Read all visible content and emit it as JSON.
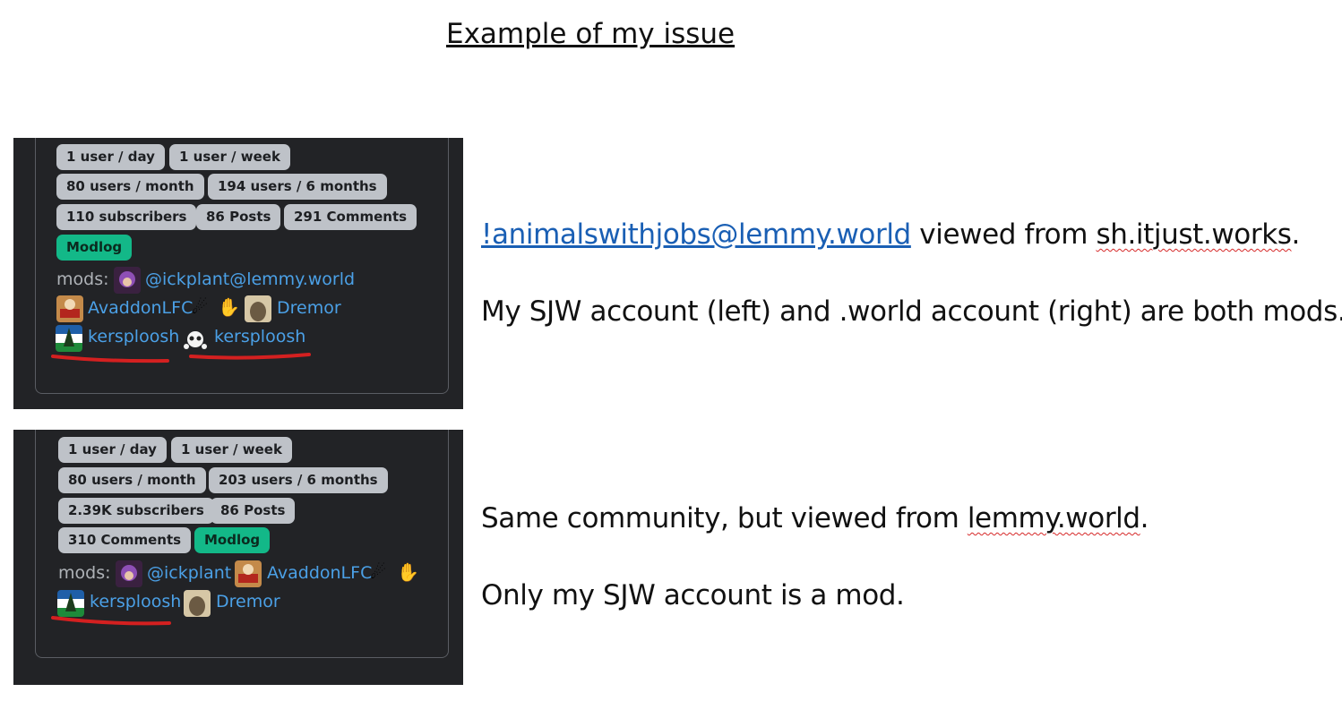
{
  "title": "Example of my issue",
  "panel1": {
    "badges": [
      "1 user / day",
      "1 user / week",
      "80 users / month",
      "194 users / 6 months",
      "110 subscribers",
      "86 Posts",
      "291 Comments"
    ],
    "modlog": "Modlog",
    "mods_label": "mods:",
    "users": [
      "@ickplant@lemmy.world",
      "AvaddonLFC",
      "Dremor",
      "kersploosh",
      "kersploosh"
    ]
  },
  "panel2": {
    "badges": [
      "1 user / day",
      "1 user / week",
      "80 users / month",
      "203 users / 6 months",
      "2.39K subscribers",
      "86 Posts",
      "310 Comments"
    ],
    "modlog": "Modlog",
    "mods_label": "mods:",
    "users": [
      "@ickplant",
      "AvaddonLFC",
      "kersploosh",
      "Dremor"
    ]
  },
  "text1": {
    "link": "!animalswithjobs@lemmy.world",
    "mid": " viewed from ",
    "site": "sh.itjust.works",
    "end": "."
  },
  "text2": "My SJW account (left) and .world account (right) are both mods.",
  "text3": {
    "start": "Same community, but viewed from ",
    "site": "lemmy.world",
    "end": "."
  },
  "text4": "Only my SJW account is a mod.",
  "colors": {
    "panel_bg": "#222326",
    "badge_bg": "#bec2c8",
    "modlog_bg": "#13b888",
    "user_link": "#4ba0e6",
    "annotation_red": "#d42020"
  }
}
